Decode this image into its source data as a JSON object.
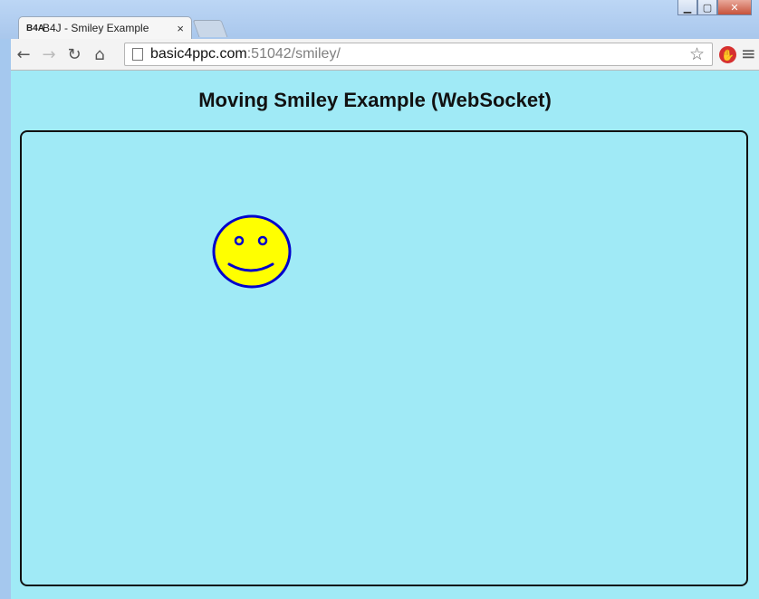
{
  "browser": {
    "tab": {
      "favicon": "B4A",
      "title": "B4J - Smiley Example",
      "close": "×"
    },
    "url": {
      "host": "basic4ppc.com",
      "path": ":51042/smiley/"
    },
    "icons": {
      "back": "back-arrow-icon",
      "forward": "forward-arrow-icon",
      "reload": "reload-icon",
      "home": "home-icon",
      "bookmark": "star-icon",
      "extension": "stop-extension-icon",
      "menu": "menu-icon"
    }
  },
  "page": {
    "title": "Moving Smiley Example (WebSocket)",
    "colors": {
      "background": "#a0eaf6",
      "smiley_fill": "#ffff00",
      "smiley_stroke": "#0000cc"
    }
  }
}
